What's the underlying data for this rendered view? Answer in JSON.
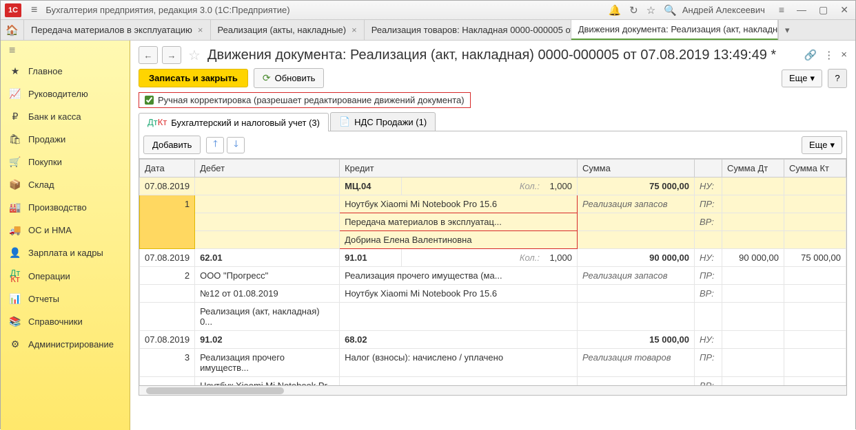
{
  "titlebar": {
    "logo": "1C",
    "app_title": "Бухгалтерия предприятия, редакция 3.0  (1С:Предприятие)",
    "user": "Андрей Алексеевич"
  },
  "tabs": {
    "items": [
      "Передача материалов в эксплуатацию",
      "Реализация (акты, накладные)",
      "Реализация товаров: Накладная 0000-000005 от 0...",
      "Движения документа: Реализация (акт, накладна..."
    ]
  },
  "sidebar": {
    "items": [
      {
        "icon": "★",
        "label": "Главное"
      },
      {
        "icon": "📈",
        "label": "Руководителю"
      },
      {
        "icon": "₽",
        "label": "Банк и касса"
      },
      {
        "icon": "🛍",
        "label": "Продажи"
      },
      {
        "icon": "🛒",
        "label": "Покупки"
      },
      {
        "icon": "📦",
        "label": "Склад"
      },
      {
        "icon": "🏭",
        "label": "Производство"
      },
      {
        "icon": "🚚",
        "label": "ОС и НМА"
      },
      {
        "icon": "👤",
        "label": "Зарплата и кадры"
      },
      {
        "icon": "Дт",
        "label": "Операции"
      },
      {
        "icon": "📊",
        "label": "Отчеты"
      },
      {
        "icon": "📚",
        "label": "Справочники"
      },
      {
        "icon": "⚙",
        "label": "Администрирование"
      }
    ]
  },
  "page": {
    "title": "Движения документа: Реализация (акт, накладная) 0000-000005 от 07.08.2019 13:49:49 *",
    "save_close": "Записать и закрыть",
    "refresh": "Обновить",
    "more": "Еще",
    "checkbox_label": "Ручная корректировка (разрешает редактирование движений документа)",
    "inner_tabs": [
      "Бухгалтерский и налоговый учет (3)",
      "НДС Продажи (1)"
    ],
    "add_btn": "Добавить"
  },
  "grid": {
    "headers": {
      "date": "Дата",
      "debit": "Дебет",
      "credit": "Кредит",
      "sum": "Сумма",
      "sum_dt": "Сумма Дт",
      "sum_kt": "Сумма Кт"
    },
    "kol_label": "Кол.:",
    "nu": "НУ:",
    "pr": "ПР:",
    "vr": "ВР:",
    "rows": [
      {
        "date": "07.08.2019",
        "seq": "1",
        "debit_acc": "",
        "credit_acc": "МЦ.04",
        "qty": "1,000",
        "sum": "75 000,00",
        "credit_lines": [
          "Ноутбук Xiaomi Mi Notebook Pro 15.6",
          "Передача материалов в эксплуатац...",
          "Добрина Елена Валентиновна"
        ],
        "sum_desc": "Реализация запасов",
        "highlighted": true
      },
      {
        "date": "07.08.2019",
        "seq": "2",
        "debit_acc": "62.01",
        "credit_acc": "91.01",
        "qty": "1,000",
        "sum": "90 000,00",
        "sum_dt": "90 000,00",
        "sum_kt": "75 000,00",
        "debit_lines": [
          "ООО \"Прогресс\"",
          "№12 от 01.08.2019",
          "Реализация (акт, накладная) 0..."
        ],
        "credit_lines": [
          "Реализация прочего имущества (ма...",
          "Ноутбук Xiaomi Mi Notebook Pro 15.6"
        ],
        "sum_desc": "Реализация запасов"
      },
      {
        "date": "07.08.2019",
        "seq": "3",
        "debit_acc": "91.02",
        "credit_acc": "68.02",
        "sum": "15 000,00",
        "debit_lines": [
          "Реализация прочего имуществ...",
          "Ноутбук Xiaomi Mi Notebook Pr..."
        ],
        "credit_lines": [
          "Налог (взносы): начислено / уплачено"
        ],
        "sum_desc": "Реализация товаров"
      }
    ]
  }
}
